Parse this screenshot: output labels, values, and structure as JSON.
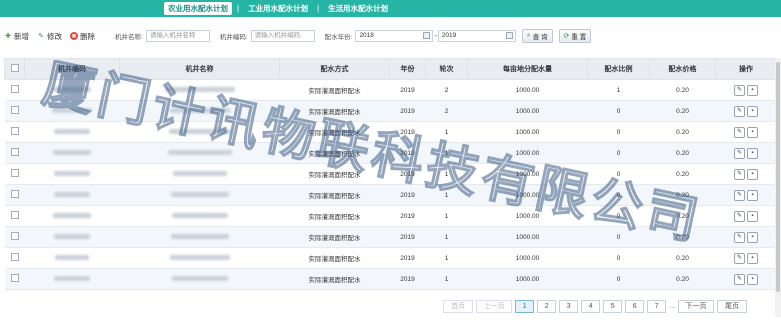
{
  "tabs": [
    {
      "label": "农业用水配水计划",
      "active": true
    },
    {
      "label": "工业用水配水计划",
      "active": false
    },
    {
      "label": "生活用水配水计划",
      "active": false
    }
  ],
  "tab_separator": "|",
  "toolbar": {
    "add_label": "新增",
    "edit_label": "修改",
    "delete_label": "删除",
    "well_name_label": "机井名称:",
    "well_name_placeholder": "请输入机井名称",
    "well_code_label": "机井编码:",
    "well_code_placeholder": "请输入机井编码",
    "year_label": "配水年份:",
    "year_from": "2018",
    "year_sep": "-",
    "year_to": "2019",
    "query_label": "查 询",
    "reset_label": "重 置"
  },
  "table": {
    "headers": [
      "机井编码",
      "机井名称",
      "配水方式",
      "年份",
      "轮次",
      "每亩地分配水量",
      "配水比例",
      "配水价格",
      "操作"
    ],
    "rows": [
      {
        "method": "实际灌溉面积配水",
        "year": "2019",
        "round": "2",
        "amount": "1000.00",
        "ratio": "1",
        "price": "0.20"
      },
      {
        "method": "实际灌溉面积配水",
        "year": "2019",
        "round": "2",
        "amount": "1000.00",
        "ratio": "0",
        "price": "0.20"
      },
      {
        "method": "实际灌溉面积配水",
        "year": "2019",
        "round": "1",
        "amount": "1000.00",
        "ratio": "0",
        "price": "0.20"
      },
      {
        "method": "实际灌溉面积配水",
        "year": "2019",
        "round": "1",
        "amount": "1000.00",
        "ratio": "0",
        "price": "0.20"
      },
      {
        "method": "实际灌溉面积配水",
        "year": "2019",
        "round": "1",
        "amount": "1000.00",
        "ratio": "0",
        "price": "0.20"
      },
      {
        "method": "实际灌溉面积配水",
        "year": "2019",
        "round": "1",
        "amount": "1000.00",
        "ratio": "0",
        "price": "0.20"
      },
      {
        "method": "实际灌溉面积配水",
        "year": "2019",
        "round": "1",
        "amount": "1000.00",
        "ratio": "0",
        "price": "0.20"
      },
      {
        "method": "实际灌溉面积配水",
        "year": "2019",
        "round": "1",
        "amount": "1000.00",
        "ratio": "0",
        "price": "0.20"
      },
      {
        "method": "实际灌溉面积配水",
        "year": "2019",
        "round": "1",
        "amount": "1000.00",
        "ratio": "0",
        "price": "0.20"
      },
      {
        "method": "实际灌溉面积配水",
        "year": "2019",
        "round": "1",
        "amount": "1000.00",
        "ratio": "0",
        "price": "0.20"
      }
    ]
  },
  "watermark": "厦门计讯物联科技有限公司",
  "pager": {
    "first": "首页",
    "prev": "上一页",
    "pages": [
      "1",
      "2",
      "3",
      "4",
      "5",
      "6",
      "7"
    ],
    "current": "1",
    "ellipsis": "...",
    "next": "下一页",
    "last": "尾页"
  },
  "colors": {
    "header_bar": "#26b5a4",
    "accent": "#1a8f84"
  }
}
